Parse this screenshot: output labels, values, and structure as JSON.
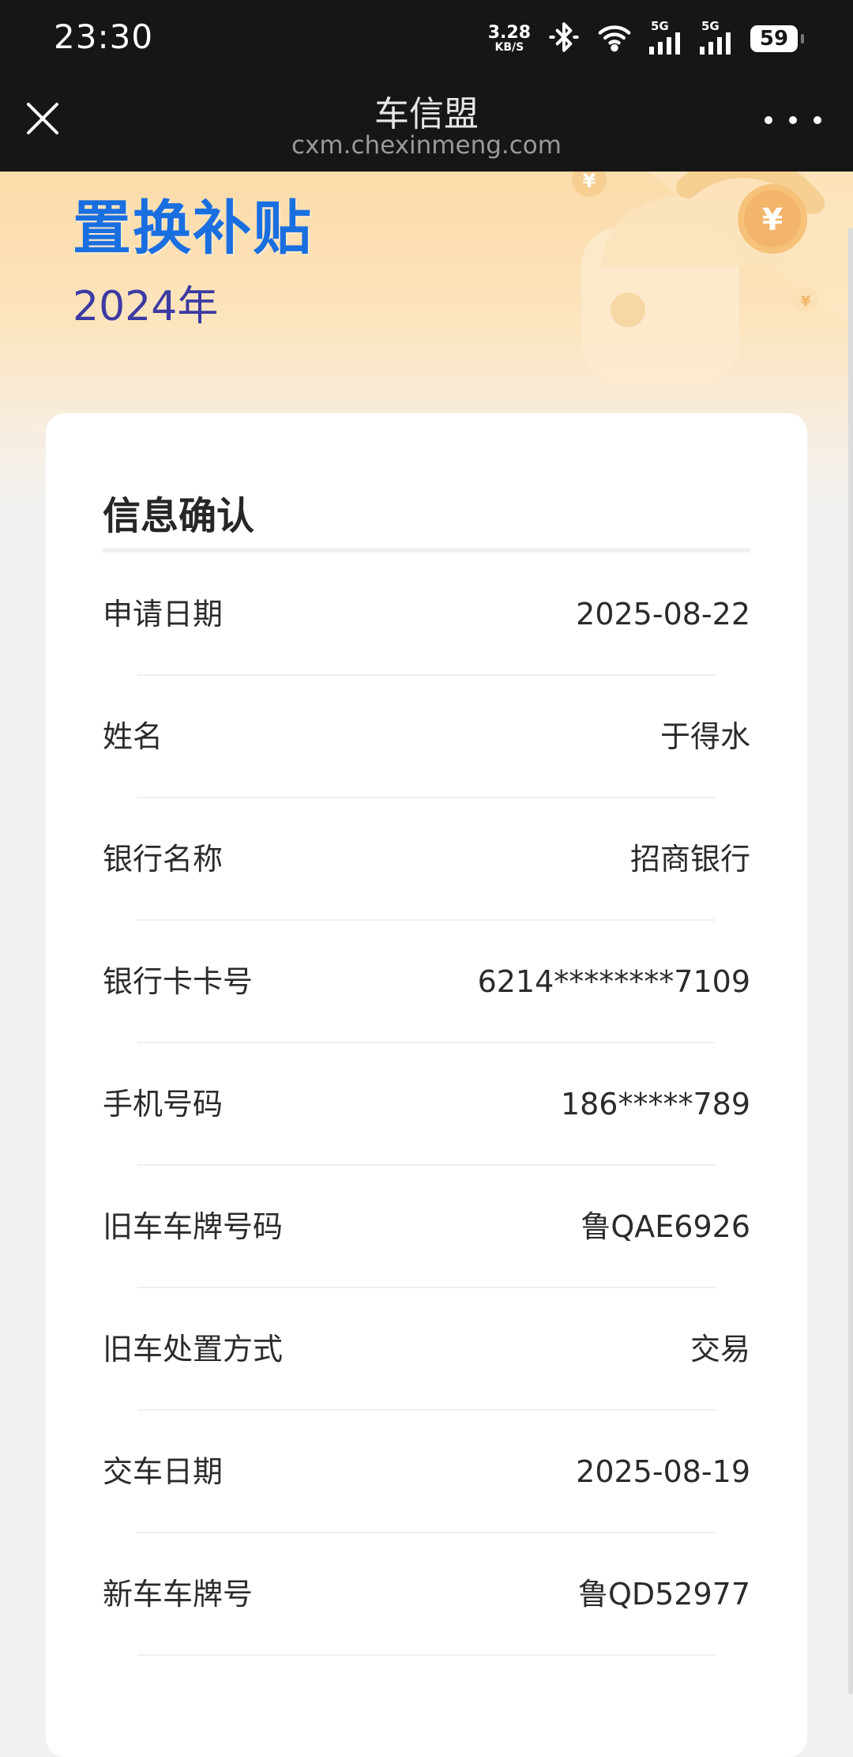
{
  "status_bar": {
    "time": "23:30",
    "net_speed_value": "3.28",
    "net_speed_unit": "KB/S",
    "signal1_label": "5G",
    "signal2_label": "5G",
    "battery": "59"
  },
  "browser": {
    "title": "车信盟",
    "url": "cxm.chexinmeng.com"
  },
  "banner": {
    "title": "置换补贴",
    "year": "2024年"
  },
  "section": {
    "title": "信息确认"
  },
  "rows": [
    {
      "label": "申请日期",
      "value": "2025-08-22"
    },
    {
      "label": "姓名",
      "value": "于得水"
    },
    {
      "label": "银行名称",
      "value": "招商银行"
    },
    {
      "label": "银行卡卡号",
      "value": "6214********7109"
    },
    {
      "label": "手机号码",
      "value": "186*****789"
    },
    {
      "label": "旧车车牌号码",
      "value": "鲁QAE6926"
    },
    {
      "label": "旧车处置方式",
      "value": "交易"
    },
    {
      "label": "交车日期",
      "value": "2025-08-19"
    },
    {
      "label": "新车车牌号",
      "value": "鲁QD52977"
    }
  ],
  "colors": {
    "banner_title": "#1a6fe0",
    "banner_year": "#3c3aa3",
    "top_bar": "#161616",
    "banner_gradient": "#fbdcaa"
  },
  "icons": {
    "close": "close-icon",
    "more": "more-dots-icon",
    "bluetooth": "bluetooth-icon",
    "wifi": "wifi-icon",
    "signal": "signal-bars-icon",
    "battery": "battery-icon"
  }
}
